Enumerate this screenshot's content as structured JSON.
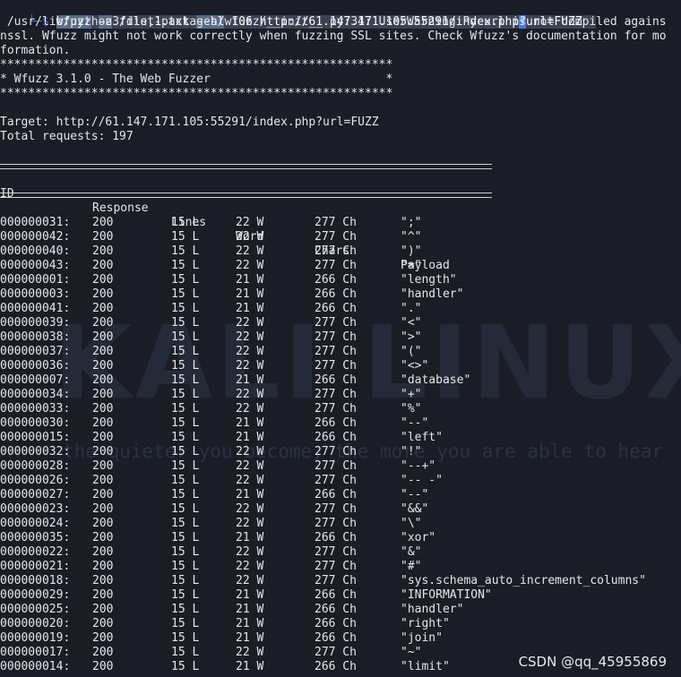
{
  "prompt": {
    "arrow": "└─$",
    "parts": [
      {
        "text": "wfuzz",
        "style": "highlight"
      },
      {
        "text": " ",
        "style": "normal"
      },
      {
        "text": "-z",
        "style": "highlight"
      },
      {
        "text": " file,1.txt ",
        "style": "normal"
      },
      {
        "text": "--hl",
        "style": "highlight"
      },
      {
        "text": " 106 http://61.147.171.105:55291/index.php",
        "style": "normal"
      },
      {
        "text": "?",
        "style": "cursor"
      },
      {
        "text": "url=FUZZ  ",
        "style": "normal"
      }
    ]
  },
  "warning_lines": [
    " /usr/lib/python3/dist-packages/wfuzz/__init__.py:34: UserWarning:Pycurl is not compiled agains",
    "nssl. Wfuzz might not work correctly when fuzzing SSL sites. Check Wfuzz's documentation for mo",
    "formation."
  ],
  "banner": {
    "border": "********************************************************",
    "title": "* Wfuzz 3.1.0 - The Web Fuzzer                         *"
  },
  "target_line": "Target: http://61.147.171.105:55291/index.php?url=FUZZ",
  "total_line": "Total requests: 197",
  "table": {
    "headers": {
      "id": "ID",
      "response": "Response",
      "lines": "Lines",
      "word": "Word",
      "chars": "Chars",
      "payload": "Payload"
    },
    "rows": [
      {
        "id": "000000031:",
        "response": "200",
        "lines": "15 L",
        "word": "22 W",
        "chars": "277 Ch",
        "payload": "\";\""
      },
      {
        "id": "000000042:",
        "response": "200",
        "lines": "15 L",
        "word": "22 W",
        "chars": "277 Ch",
        "payload": "\"^\""
      },
      {
        "id": "000000040:",
        "response": "200",
        "lines": "15 L",
        "word": "22 W",
        "chars": "277 Ch",
        "payload": "\")\""
      },
      {
        "id": "000000043:",
        "response": "200",
        "lines": "15 L",
        "word": "22 W",
        "chars": "277 Ch",
        "payload": "\"=\""
      },
      {
        "id": "000000001:",
        "response": "200",
        "lines": "15 L",
        "word": "21 W",
        "chars": "266 Ch",
        "payload": "\"length\""
      },
      {
        "id": "000000003:",
        "response": "200",
        "lines": "15 L",
        "word": "21 W",
        "chars": "266 Ch",
        "payload": "\"handler\""
      },
      {
        "id": "000000041:",
        "response": "200",
        "lines": "15 L",
        "word": "21 W",
        "chars": "266 Ch",
        "payload": "\".\""
      },
      {
        "id": "000000039:",
        "response": "200",
        "lines": "15 L",
        "word": "22 W",
        "chars": "277 Ch",
        "payload": "\"<\""
      },
      {
        "id": "000000038:",
        "response": "200",
        "lines": "15 L",
        "word": "22 W",
        "chars": "277 Ch",
        "payload": "\">\""
      },
      {
        "id": "000000037:",
        "response": "200",
        "lines": "15 L",
        "word": "22 W",
        "chars": "277 Ch",
        "payload": "\"(\""
      },
      {
        "id": "000000036:",
        "response": "200",
        "lines": "15 L",
        "word": "22 W",
        "chars": "277 Ch",
        "payload": "\"<>\""
      },
      {
        "id": "000000007:",
        "response": "200",
        "lines": "15 L",
        "word": "21 W",
        "chars": "266 Ch",
        "payload": "\"database\""
      },
      {
        "id": "000000034:",
        "response": "200",
        "lines": "15 L",
        "word": "22 W",
        "chars": "277 Ch",
        "payload": "\"+\""
      },
      {
        "id": "000000033:",
        "response": "200",
        "lines": "15 L",
        "word": "22 W",
        "chars": "277 Ch",
        "payload": "\"%\""
      },
      {
        "id": "000000030:",
        "response": "200",
        "lines": "15 L",
        "word": "21 W",
        "chars": "266 Ch",
        "payload": "\"--\""
      },
      {
        "id": "000000015:",
        "response": "200",
        "lines": "15 L",
        "word": "21 W",
        "chars": "266 Ch",
        "payload": "\"left\""
      },
      {
        "id": "000000032:",
        "response": "200",
        "lines": "15 L",
        "word": "22 W",
        "chars": "277 Ch",
        "payload": "\"!\""
      },
      {
        "id": "000000028:",
        "response": "200",
        "lines": "15 L",
        "word": "22 W",
        "chars": "277 Ch",
        "payload": "\"--+\""
      },
      {
        "id": "000000026:",
        "response": "200",
        "lines": "15 L",
        "word": "22 W",
        "chars": "277 Ch",
        "payload": "\"-- -\""
      },
      {
        "id": "000000027:",
        "response": "200",
        "lines": "15 L",
        "word": "21 W",
        "chars": "266 Ch",
        "payload": "\"--\""
      },
      {
        "id": "000000023:",
        "response": "200",
        "lines": "15 L",
        "word": "22 W",
        "chars": "277 Ch",
        "payload": "\"&&\""
      },
      {
        "id": "000000024:",
        "response": "200",
        "lines": "15 L",
        "word": "22 W",
        "chars": "277 Ch",
        "payload": "\"\\\""
      },
      {
        "id": "000000035:",
        "response": "200",
        "lines": "15 L",
        "word": "21 W",
        "chars": "266 Ch",
        "payload": "\"xor\""
      },
      {
        "id": "000000022:",
        "response": "200",
        "lines": "15 L",
        "word": "22 W",
        "chars": "277 Ch",
        "payload": "\"&\""
      },
      {
        "id": "000000021:",
        "response": "200",
        "lines": "15 L",
        "word": "22 W",
        "chars": "277 Ch",
        "payload": "\"#\""
      },
      {
        "id": "000000018:",
        "response": "200",
        "lines": "15 L",
        "word": "22 W",
        "chars": "277 Ch",
        "payload": "\"sys.schema_auto_increment_columns\""
      },
      {
        "id": "000000029:",
        "response": "200",
        "lines": "15 L",
        "word": "21 W",
        "chars": "266 Ch",
        "payload": "\"INFORMATION\""
      },
      {
        "id": "000000025:",
        "response": "200",
        "lines": "15 L",
        "word": "21 W",
        "chars": "266 Ch",
        "payload": "\"handler\""
      },
      {
        "id": "000000020:",
        "response": "200",
        "lines": "15 L",
        "word": "21 W",
        "chars": "266 Ch",
        "payload": "\"right\""
      },
      {
        "id": "000000019:",
        "response": "200",
        "lines": "15 L",
        "word": "21 W",
        "chars": "266 Ch",
        "payload": "\"join\""
      },
      {
        "id": "000000017:",
        "response": "200",
        "lines": "15 L",
        "word": "22 W",
        "chars": "277 Ch",
        "payload": "\"~\""
      },
      {
        "id": "000000014:",
        "response": "200",
        "lines": "15 L",
        "word": "21 W",
        "chars": "266 Ch",
        "payload": "\"limit\""
      }
    ]
  },
  "watermark": {
    "logo": "KALI LINUX",
    "tagline": "the quieter you become, the more you are able to hear"
  },
  "csdn_credit": "CSDN @qq_45955869",
  "colors": {
    "background": "#1a1d26",
    "text": "#e6e6e6",
    "prompt_arrow": "#3f6fd1",
    "highlight_bg": "#5a6b88",
    "cursor_bg": "#3f7be8"
  }
}
